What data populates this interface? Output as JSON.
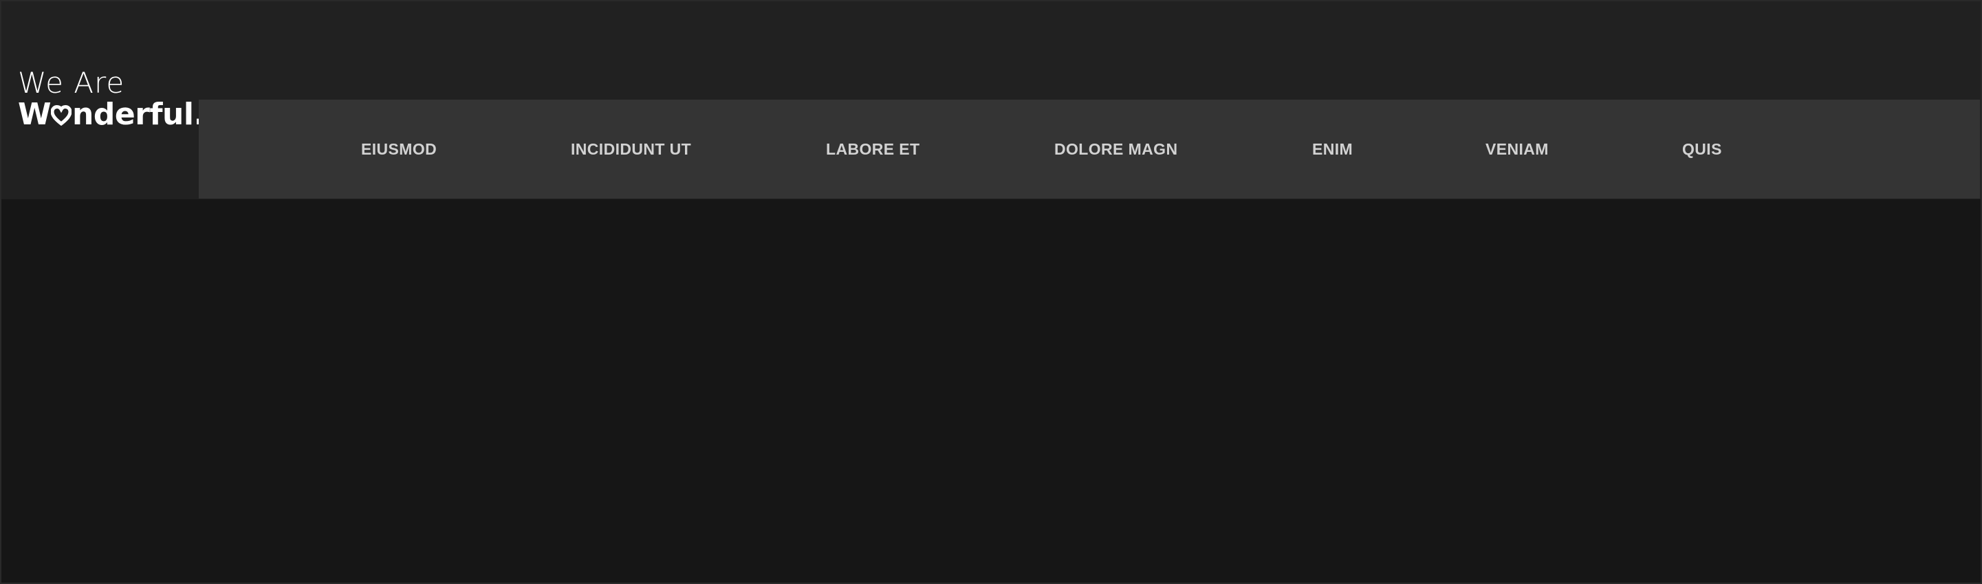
{
  "logo": {
    "line1": "We Are",
    "line2_prefix": "W",
    "line2_suffix": "nderful.",
    "heart_icon": "heart-icon"
  },
  "nav": {
    "items": [
      {
        "label": "EIUSMOD"
      },
      {
        "label": "INCIDIDUNT UT"
      },
      {
        "label": "LABORE ET"
      },
      {
        "label": "DOLORE MAGN"
      },
      {
        "label": "ENIM"
      },
      {
        "label": "VENIAM"
      },
      {
        "label": "QUIS"
      }
    ]
  },
  "colors": {
    "header_bg": "#212121",
    "nav_bg": "#343434",
    "page_bg": "#161616",
    "nav_text": "#d2d2d2",
    "logo_text": "#ffffff"
  }
}
